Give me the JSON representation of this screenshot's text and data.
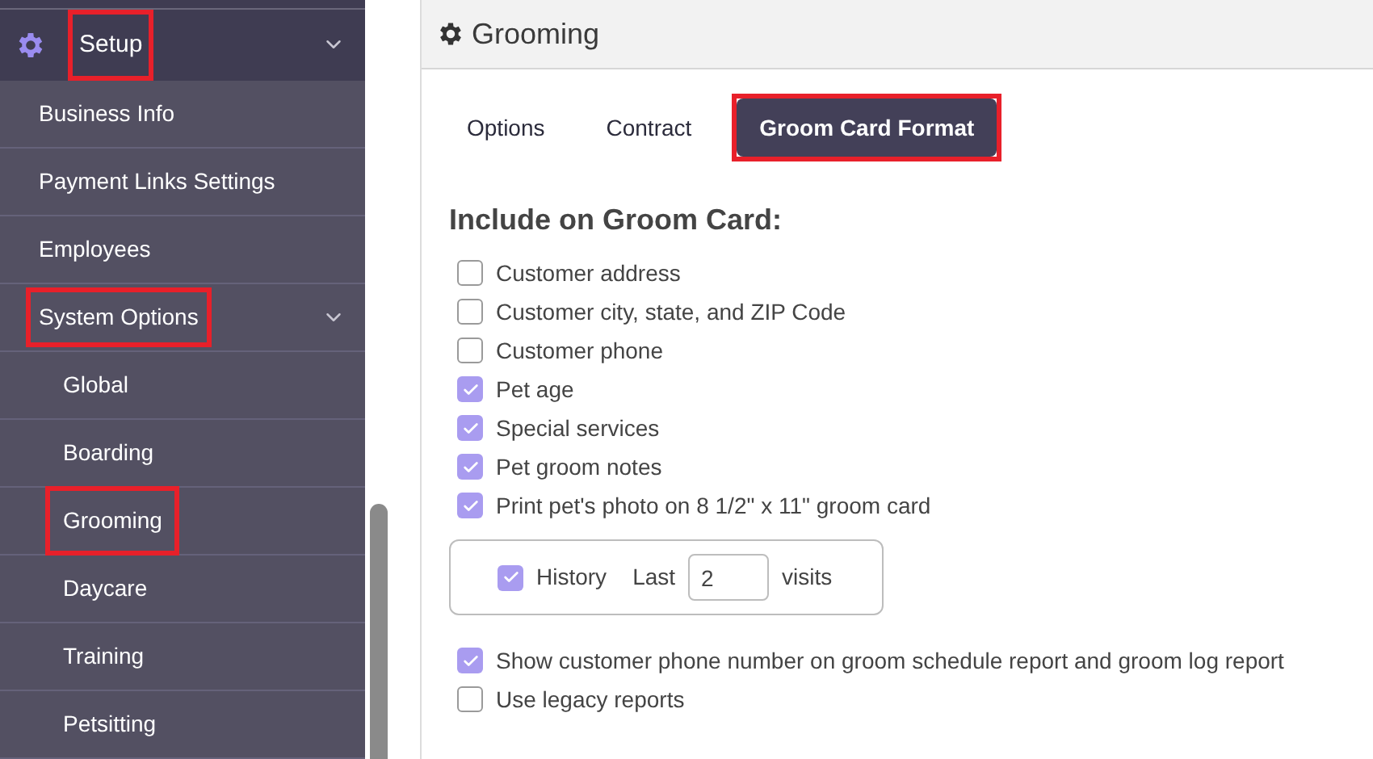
{
  "sidebar": {
    "section": {
      "label": "Setup",
      "expanded": true,
      "highlighted": true,
      "items": [
        {
          "label": "Business Info",
          "highlighted": false
        },
        {
          "label": "Payment Links Settings",
          "highlighted": false
        },
        {
          "label": "Employees",
          "highlighted": false
        },
        {
          "label": "System Options",
          "highlighted": true,
          "expanded": true,
          "children": [
            {
              "label": "Global",
              "highlighted": false
            },
            {
              "label": "Boarding",
              "highlighted": false
            },
            {
              "label": "Grooming",
              "highlighted": true
            },
            {
              "label": "Daycare",
              "highlighted": false
            },
            {
              "label": "Training",
              "highlighted": false
            },
            {
              "label": "Petsitting",
              "highlighted": false
            }
          ]
        }
      ]
    }
  },
  "panel": {
    "title": "Grooming",
    "tabs": [
      {
        "label": "Options",
        "selected": false,
        "highlighted": false
      },
      {
        "label": "Contract",
        "selected": false,
        "highlighted": false
      },
      {
        "label": "Groom Card Format",
        "selected": true,
        "highlighted": true
      }
    ],
    "heading": "Include on Groom Card:",
    "options": [
      {
        "label": "Customer address",
        "checked": false
      },
      {
        "label": "Customer city, state, and ZIP Code",
        "checked": false
      },
      {
        "label": "Customer phone",
        "checked": false
      },
      {
        "label": "Pet age",
        "checked": true
      },
      {
        "label": "Special services",
        "checked": true
      },
      {
        "label": "Pet groom notes",
        "checked": true
      },
      {
        "label": "Print pet's photo on 8 1/2\" x 11\" groom card",
        "checked": true
      }
    ],
    "history": {
      "label": "History",
      "checked": true,
      "prefix": "Last",
      "value": "2",
      "suffix": "visits"
    },
    "report_options": [
      {
        "label": "Show customer phone number on groom schedule report and groom log report",
        "checked": true
      },
      {
        "label": "Use legacy reports",
        "checked": false
      }
    ]
  }
}
